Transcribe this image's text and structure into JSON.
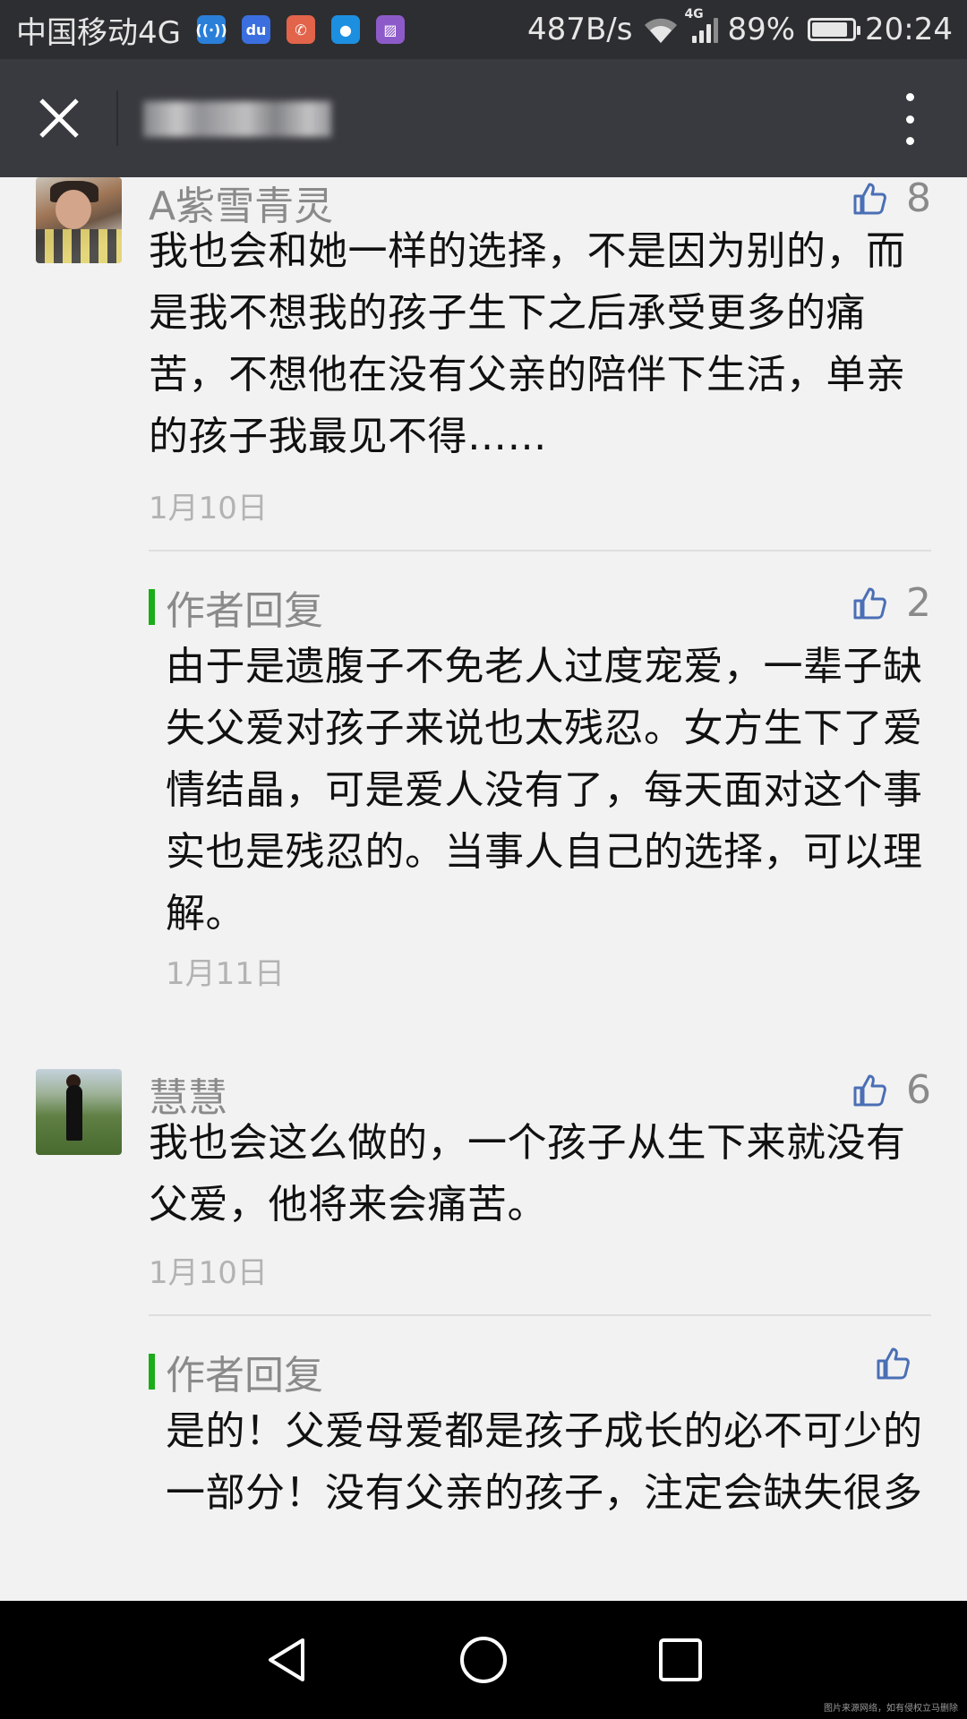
{
  "status_bar": {
    "carrier": "中国移动4G",
    "app_icons": [
      "wifi-share-icon",
      "baidu-icon",
      "missed-call-icon",
      "message-icon",
      "gallery-icon"
    ],
    "net_speed": "487B/s",
    "network_tag": "4G",
    "battery_percent": "89%",
    "battery_level": 0.89,
    "time": "20:24"
  },
  "title_bar": {
    "title_blurred": true
  },
  "comments": [
    {
      "name": "A紫雪青灵",
      "likes": "8",
      "text": "我也会和她一样的选择，不是因为别的，而是我不想我的孩子生下之后承受更多的痛苦，不想他在没有父亲的陪伴下生活，单亲的孩子我最见不得……",
      "date": "1月10日",
      "reply": {
        "label": "作者回复",
        "likes": "2",
        "text": "由于是遗腹子不免老人过度宠爱，一辈子缺失父爱对孩子来说也太残忍。女方生下了爱情结晶，可是爱人没有了，每天面对这个事实也是残忍的。当事人自己的选择，可以理解。",
        "date": "1月11日"
      }
    },
    {
      "name": "慧慧",
      "likes": "6",
      "text": "我也会这么做的，一个孩子从生下来就没有父爱，他将来会痛苦。",
      "date": "1月10日",
      "reply": {
        "label": "作者回复",
        "likes": "",
        "text": "是的！父爱母爱都是孩子成长的必不可少的一部分！没有父亲的孩子，注定会缺失很多",
        "date": ""
      }
    }
  ],
  "watermark": "图片来源网络，如有侵权立马删除",
  "colors": {
    "status_bg": "#2d2e31",
    "title_bg": "#393a3f",
    "page_bg": "#f2f2f2",
    "reply_accent": "#1aad19",
    "like_icon": "#4a6fb5"
  }
}
